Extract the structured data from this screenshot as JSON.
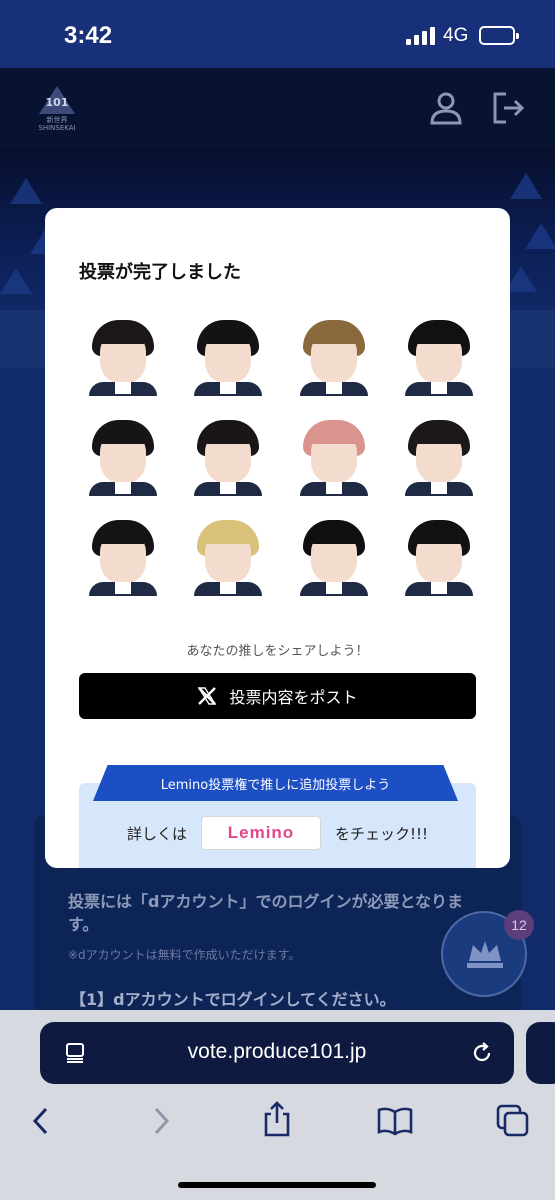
{
  "status": {
    "time": "3:42",
    "network": "4G"
  },
  "app": {
    "logo_text": "PRODUCE 101",
    "logo_num": "101",
    "logo_sub": "新世界 SHINSEKAI"
  },
  "modal": {
    "title": "投票が完了しました",
    "share_prompt": "あなたの推しをシェアしよう！",
    "post_button": "投票内容をポスト",
    "lemino_banner": "Lemino投票権で推しに追加投票しよう",
    "lemino_prefix": "詳しくは",
    "lemino_logo": "Lemino",
    "lemino_suffix": "をチェック!!!",
    "trainees": [
      {
        "hair": "#1b1618"
      },
      {
        "hair": "#141214"
      },
      {
        "hair": "#8a6a3c"
      },
      {
        "hair": "#121012"
      },
      {
        "hair": "#161416"
      },
      {
        "hair": "#1a1517"
      },
      {
        "hair": "#d9948e"
      },
      {
        "hair": "#1c1718"
      },
      {
        "hair": "#151315"
      },
      {
        "hair": "#d8c27a"
      },
      {
        "hair": "#100e10"
      },
      {
        "hair": "#131113"
      }
    ]
  },
  "background": {
    "login_note": "投票には「dアカウント」でのログインが必要となります。",
    "login_sub": "※dアカウントは無料で作成いただけます。",
    "login_step": "【1】dアカウントでログインしてください。",
    "badge_count": "12"
  },
  "browser": {
    "url": "vote.produce101.jp"
  },
  "colors": {
    "accent": "#1d4fc4",
    "post": "#000000",
    "header": "#18307a"
  }
}
